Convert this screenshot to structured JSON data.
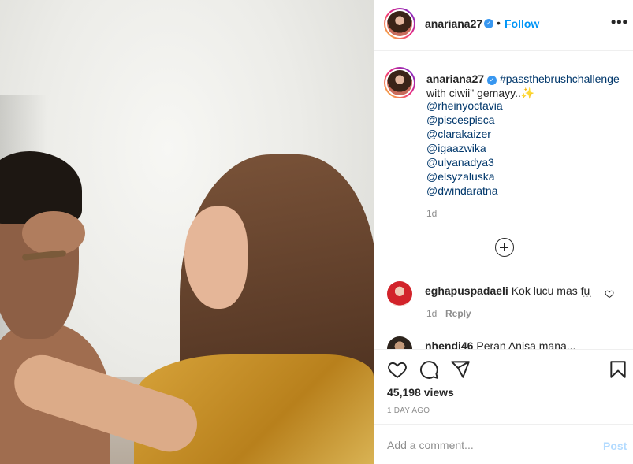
{
  "post": {
    "username": "anariana27",
    "verified_mark": "✓",
    "separator": "•",
    "follow_label": "Follow",
    "more_label": "•••"
  },
  "caption": {
    "username": "anariana27",
    "hashtag": "#passthebrushchallenge",
    "text": " with ciwii\" gemayy..",
    "emoji": "✨",
    "mentions": [
      "@rheinyoctavia",
      "@piscespisca",
      "@clarakaizer",
      "@igaazwika",
      "@ulyanadya3",
      "@elsyzaluska",
      "@dwindaratna"
    ],
    "time": "1d"
  },
  "comments": [
    {
      "username": "eghapuspadaeli",
      "text": "Kok lucu mas fu",
      "time": "1d",
      "reply_label": "Reply",
      "more": "..."
    },
    {
      "username": "nhendi46",
      "text": "Peran Anisa mana..."
    }
  ],
  "actions": {
    "icons": [
      "heart-icon",
      "comment-icon",
      "share-icon",
      "save-icon"
    ],
    "views": "45,198 views",
    "time_ago": "1 DAY AGO"
  },
  "add_comment": {
    "placeholder": "Add a comment...",
    "post_label": "Post"
  },
  "colors": {
    "accent": "#0095f6",
    "verified": "#3897f0",
    "muted": "#8e8e8e",
    "mention": "#00376b"
  }
}
